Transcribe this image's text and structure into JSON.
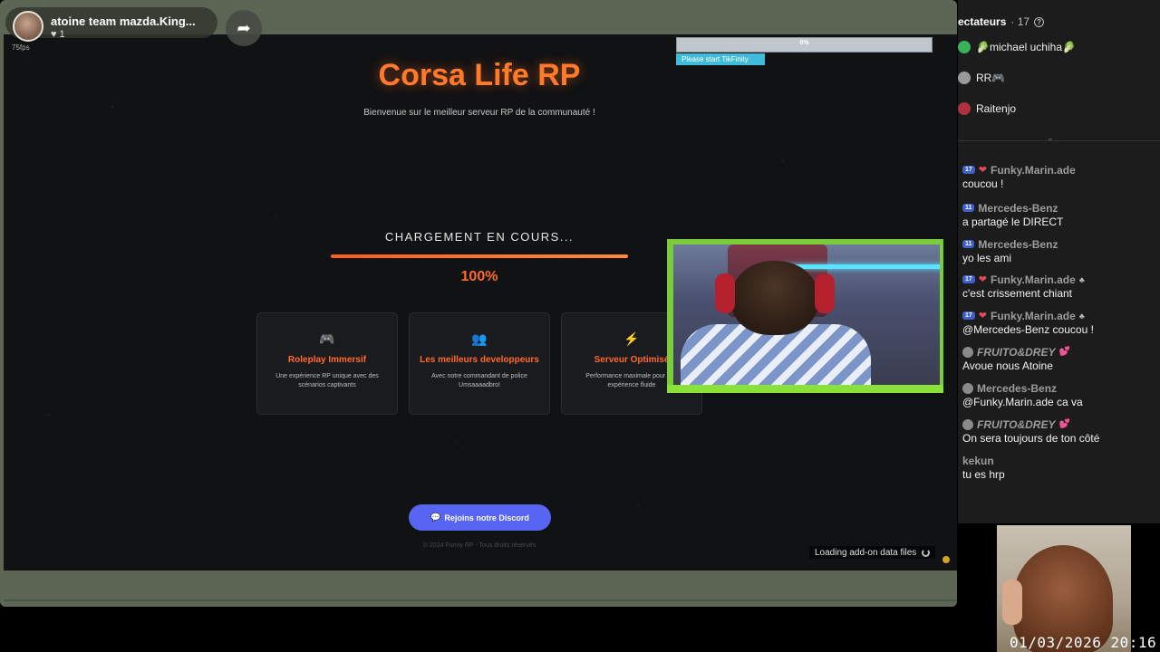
{
  "stream_header": {
    "streamer_name": "atoine team mazda.King...",
    "likes_icon": "heart-icon",
    "likes": "1",
    "fps": "75fps",
    "share_icon": "share-arrow-icon"
  },
  "game_screen": {
    "title": "Corsa Life RP",
    "subtitle": "Bienvenue sur le meilleur serveur RP de la communauté !",
    "loading_label": "CHARGEMENT EN COURS...",
    "progress_value": 1.0,
    "progress_text": "100%",
    "cards": [
      {
        "icon": "gamepad-icon",
        "glyph": "🎮",
        "title": "Roleplay Immersif",
        "desc": "Une expérience RP unique avec des scénarios captivants"
      },
      {
        "icon": "people-icon",
        "glyph": "👥",
        "title": "Les meilleurs developpeurs",
        "desc": "Avec notre commandant de police Umsaaaadbro!"
      },
      {
        "icon": "lightning-icon",
        "glyph": "⚡",
        "title": "Serveur Optimisé",
        "desc": "Performance maximale pour une expérience fluide"
      }
    ],
    "discord_button": "Rejoins notre Discord",
    "copyright": "© 2024 Funny RP - Tous droits réservés",
    "addon_status": "Loading add-on data files"
  },
  "tikfinity": {
    "progress_value": 0.0,
    "progress_text": "0%",
    "hint": "Please start TikFinity"
  },
  "viewers": {
    "label": "ectateurs",
    "count": "· 17",
    "list": [
      {
        "name": "michael uchiha",
        "decor": "🥬",
        "color": "#3bb15a"
      },
      {
        "name": "RR",
        "decor": "🎮",
        "color": "#9a9a9a"
      },
      {
        "name": "Raitenjo",
        "decor": "",
        "color": "#b03040"
      }
    ]
  },
  "chat": [
    {
      "badge": "17",
      "heart": true,
      "user": "Funky.Marin.ade",
      "text": "coucou !",
      "mod": false
    },
    {
      "badge": "11",
      "heart": false,
      "user": "Mercedes-Benz",
      "text": " a partagé le DIRECT",
      "mod": false
    },
    {
      "badge": "11",
      "heart": false,
      "user": "Mercedes-Benz",
      "text": "yo les ami",
      "mod": false
    },
    {
      "badge": "17",
      "heart": true,
      "user": "Funky.Marin.ade",
      "text": "c'est crissement chiant",
      "mod": true
    },
    {
      "badge": "17",
      "heart": true,
      "user": "Funky.Marin.ade",
      "text": "@Mercedes-Benz coucou !",
      "mod": true
    },
    {
      "badge": "",
      "heart": false,
      "grey": true,
      "user": "FRUITO&DREY",
      "italic": true,
      "text": "Avoue nous Atoine",
      "mod": false
    },
    {
      "badge": "",
      "heart": false,
      "grey": true,
      "user": "Mercedes-Benz",
      "text": "@Funky.Marin.ade ca va",
      "mod": false
    },
    {
      "badge": "",
      "heart": false,
      "grey": true,
      "user": "FRUITO&DREY",
      "italic": true,
      "text": "On sera toujours de ton côté",
      "mod": false
    },
    {
      "badge": "",
      "heart": false,
      "user": "kekun",
      "text": "tu es hrp",
      "mod": false
    }
  ],
  "overlay": {
    "datetime": "01/03/2026 20:16"
  },
  "colors": {
    "accent_orange": "#ff6a2a",
    "discord_blue": "#5865f2",
    "tikfinity_cyan": "#40bcd8",
    "cam_frame_green": "#88e23a"
  }
}
